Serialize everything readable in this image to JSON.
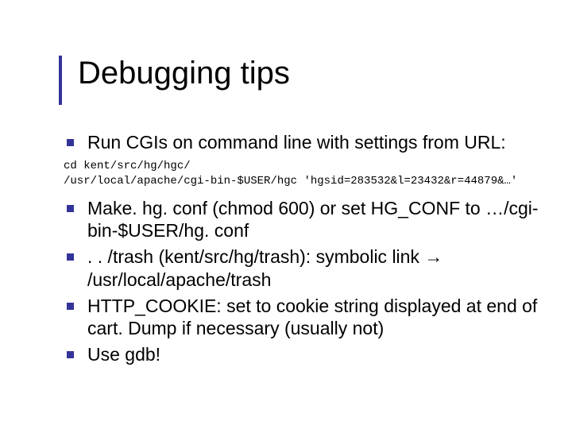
{
  "slide": {
    "title": "Debugging tips",
    "bullets_top": [
      "Run CGIs on command line with settings from URL:"
    ],
    "code_lines": [
      "cd kent/src/hg/hgc/",
      "/usr/local/apache/cgi-bin-$USER/hgc 'hgsid=283532&l=23432&r=44879&…'"
    ],
    "bullets_bottom": [
      "Make. hg. conf (chmod 600) or set HG_CONF to …/cgi-bin-$USER/hg. conf",
      ". . /trash (kent/src/hg/trash): symbolic link → /usr/local/apache/trash",
      "HTTP_COOKIE: set to cookie string displayed at end of cart. Dump if necessary (usually not)",
      "Use gdb!"
    ]
  },
  "colors": {
    "accent": "#333399"
  }
}
